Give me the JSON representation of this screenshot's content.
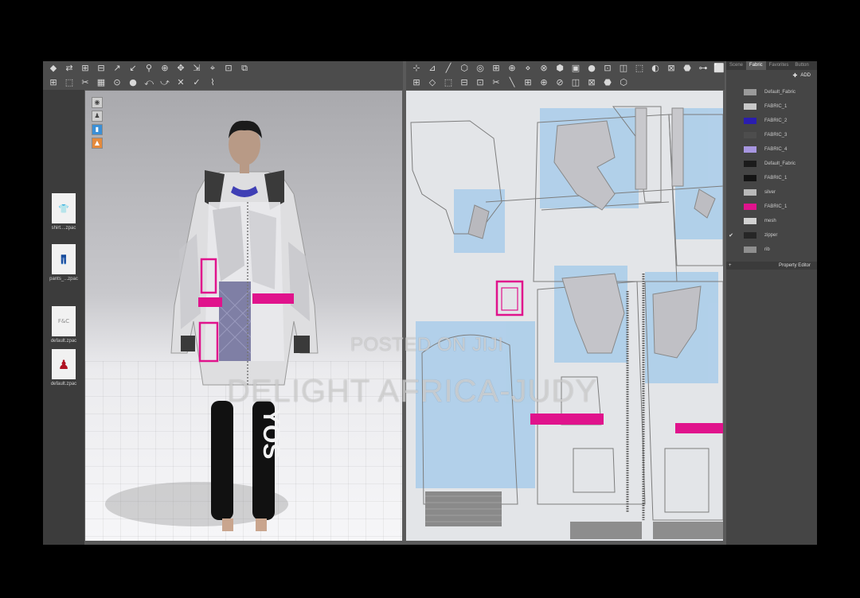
{
  "toolbar": {
    "left_row1": [
      "◆",
      "⇄",
      "⊞",
      "⊟",
      "↗",
      "↙",
      "⚲",
      "⊕",
      "✥",
      "⇲",
      "⌖",
      "⊡",
      "⧉"
    ],
    "left_row2": [
      "⊞",
      "⬚",
      "✂",
      "▦",
      "⊙",
      "●",
      "⤺",
      "⤻",
      "✕",
      "✓",
      "⌇"
    ],
    "right_row1": [
      "⊹",
      "⊿",
      "╱",
      "⬡",
      "◎",
      "⊞",
      "⊕",
      "⋄",
      "⊗",
      "⬢",
      "▣",
      "●",
      "⊡",
      "◫",
      "⬚",
      "◐",
      "⊠",
      "⬣",
      "⊶",
      "⬜",
      "⬤"
    ],
    "right_row2": [
      "⊞",
      "◇",
      "⬚",
      "⊟",
      "⊡",
      "✂",
      "╲",
      "⊞",
      "⊕",
      "⊘",
      "◫",
      "⊠",
      "⬣",
      "⬡"
    ]
  },
  "library": {
    "items": [
      {
        "label": "shirt....zpac",
        "icon": "shirt-icon",
        "glyph": "👕"
      },
      {
        "label": "pants_...zpac",
        "icon": "pants-icon",
        "glyph": "👖"
      },
      {
        "label": "default.zpac",
        "icon": "file-icon",
        "glyph": "F&C"
      },
      {
        "label": "default.zpac",
        "icon": "avatar-icon",
        "glyph": "♟"
      }
    ]
  },
  "right_panel": {
    "tabs": [
      "Scene",
      "Fabric",
      "Favorites",
      "Button"
    ],
    "active_tab": "Fabric",
    "add_label": "ADD",
    "fabrics": [
      {
        "name": "Default_Fabric",
        "color": "#9a9a9a",
        "checked": false
      },
      {
        "name": "FABRIC_1",
        "color": "#c8c8c8",
        "checked": false
      },
      {
        "name": "FABRIC_2",
        "color": "#2a1db0",
        "checked": false
      },
      {
        "name": "FABRIC_3",
        "color": "#4d4d4d",
        "checked": false
      },
      {
        "name": "FABRIC_4",
        "color": "#a796e0",
        "checked": false
      },
      {
        "name": "Default_Fabric",
        "color": "#1b1b1b",
        "checked": false
      },
      {
        "name": "FABRIC_1",
        "color": "#141414",
        "checked": false
      },
      {
        "name": "silver",
        "color": "#b9b9b9",
        "checked": false
      },
      {
        "name": "FABRIC_1",
        "color": "#e0138c",
        "checked": false
      },
      {
        "name": "mesh",
        "color": "#d2d2d2",
        "checked": false
      },
      {
        "name": "zipper",
        "color": "#262626",
        "checked": true
      },
      {
        "name": "rib",
        "color": "#8f8f8f",
        "checked": false
      }
    ],
    "property_editor_label": "Property Editor"
  },
  "watermark": {
    "line1": "POSTED ON JIJI",
    "line2": "DELIGHT AFRICA-JUDY"
  },
  "colors": {
    "accent_magenta": "#e0138c",
    "pattern_blue": "#a9cdea"
  }
}
